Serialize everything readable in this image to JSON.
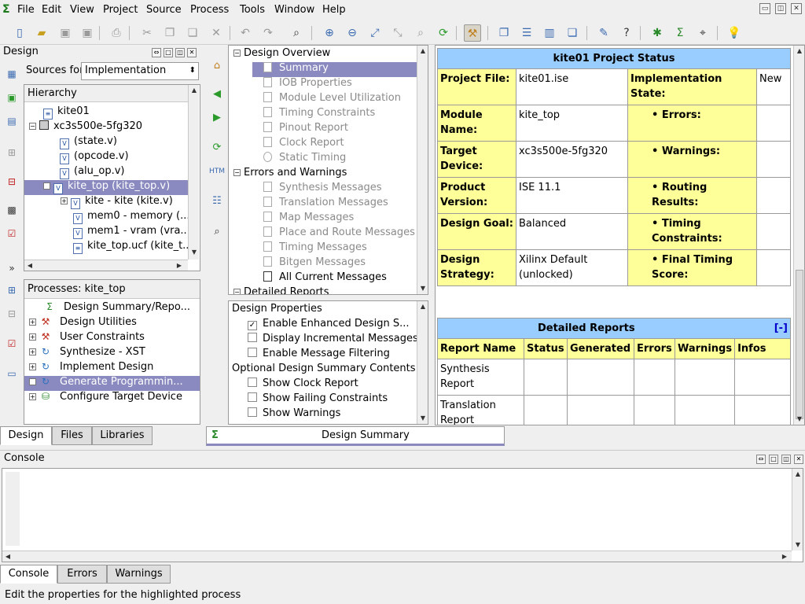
{
  "menu": [
    "File",
    "Edit",
    "View",
    "Project",
    "Source",
    "Process",
    "Tools",
    "Window",
    "Help"
  ],
  "design_panel": {
    "title": "Design",
    "sources_label": "Sources for",
    "sources_value": "Implementation",
    "hierarchy_label": "Hierarchy",
    "tree": [
      {
        "label": "kite01"
      },
      {
        "label": "xc3s500e-5fg320"
      },
      {
        "label": "(state.v)"
      },
      {
        "label": "(opcode.v)"
      },
      {
        "label": "(alu_op.v)"
      },
      {
        "label": "kite_top (kite_top.v)"
      },
      {
        "label": "kite - kite (kite.v)"
      },
      {
        "label": "mem0 - memory (..."
      },
      {
        "label": "mem1 - vram (vra..."
      },
      {
        "label": "kite_top.ucf (kite_t..."
      }
    ],
    "processes_label": "Processes: kite_top",
    "processes": [
      {
        "label": "Design Summary/Repo..."
      },
      {
        "label": "Design Utilities"
      },
      {
        "label": "User Constraints"
      },
      {
        "label": "Synthesize - XST"
      },
      {
        "label": "Implement Design"
      },
      {
        "label": "Generate Programmin..."
      },
      {
        "label": "Configure Target Device"
      }
    ],
    "tabs": [
      "Design",
      "Files",
      "Libraries"
    ]
  },
  "report_tree": {
    "overview_label": "Design Overview",
    "overview_items": [
      "Summary",
      "IOB Properties",
      "Module Level Utilization",
      "Timing Constraints",
      "Pinout Report",
      "Clock Report",
      "Static Timing"
    ],
    "errors_label": "Errors and Warnings",
    "errors_items": [
      "Synthesis Messages",
      "Translation Messages",
      "Map Messages",
      "Place and Route Messages",
      "Timing Messages",
      "Bitgen Messages",
      "All Current Messages"
    ],
    "detailed_label": "Detailed Reports"
  },
  "design_properties": {
    "title": "Design Properties",
    "items": [
      {
        "label": "Enable Enhanced Design S...",
        "checked": true
      },
      {
        "label": "Display Incremental Messages",
        "checked": false
      },
      {
        "label": "Enable Message Filtering",
        "checked": false
      }
    ],
    "optional_title": "Optional Design Summary Contents",
    "optional": [
      {
        "label": "Show Clock Report",
        "checked": false
      },
      {
        "label": "Show Failing Constraints",
        "checked": false
      },
      {
        "label": "Show Warnings",
        "checked": false
      }
    ]
  },
  "design_summary_tab": "Design Summary",
  "project_status": {
    "title": "kite01 Project Status",
    "rows": [
      {
        "l1": "Project File:",
        "v1": "kite01.ise",
        "l2": "Implementation State:",
        "v2": "New"
      },
      {
        "l1": "Module Name:",
        "v1": "kite_top",
        "l2": "Errors:",
        "v2": ""
      },
      {
        "l1": "Target Device:",
        "v1": "xc3s500e-5fg320",
        "l2": "Warnings:",
        "v2": ""
      },
      {
        "l1": "Product Version:",
        "v1": "ISE 11.1",
        "l2": "Routing Results:",
        "v2": ""
      },
      {
        "l1": "Design Goal:",
        "v1": "Balanced",
        "l2": "Timing Constraints:",
        "v2": ""
      },
      {
        "l1": "Design Strategy:",
        "v1": "Xilinx Default (unlocked)",
        "l2": "Final Timing Score:",
        "v2": ""
      }
    ]
  },
  "detailed_reports": {
    "title": "Detailed Reports",
    "toggle": "[-]",
    "columns": [
      "Report Name",
      "Status",
      "Generated",
      "Errors",
      "Warnings",
      "Infos"
    ],
    "rows": [
      "Synthesis Report",
      "Translation Report"
    ]
  },
  "console": {
    "title": "Console",
    "tabs": [
      "Console",
      "Errors",
      "Warnings"
    ]
  },
  "status_text": "Edit the properties for the highlighted process"
}
